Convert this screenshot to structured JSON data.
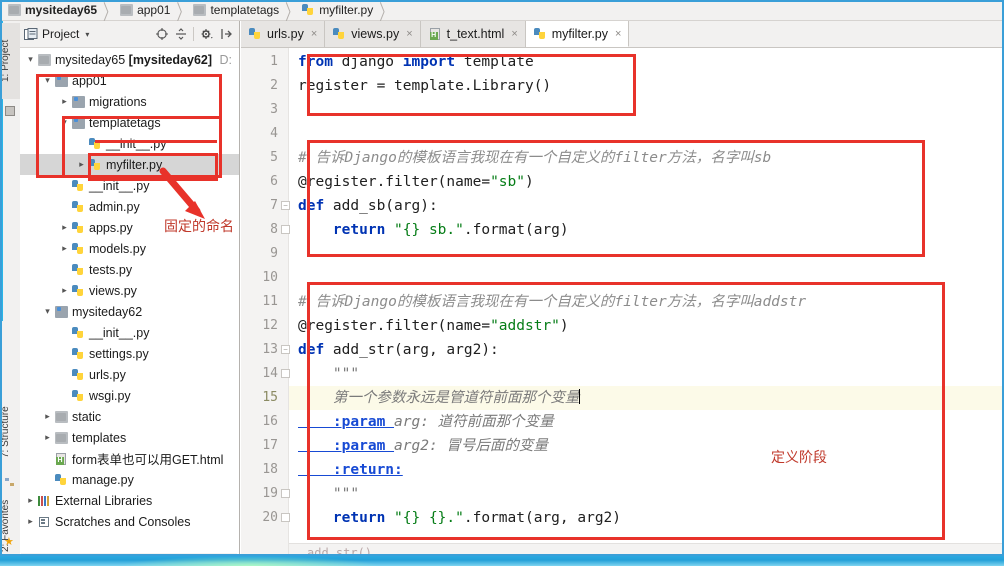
{
  "breadcrumb": {
    "items": [
      {
        "label": "mysiteday65",
        "icon": "folder-icon"
      },
      {
        "label": "app01",
        "icon": "folder-icon"
      },
      {
        "label": "templatetags",
        "icon": "folder-icon"
      },
      {
        "label": "myfilter.py",
        "icon": "python-file-icon"
      }
    ],
    "separator": "〉"
  },
  "toolstrip": {
    "project_tab": "1: Project",
    "structure_tab": "7: Structure",
    "favorites_tab": "2: Favorites",
    "star_icon": "★"
  },
  "project_panel": {
    "title": "Project",
    "caret": "▾",
    "toolbar_icons": [
      "target-icon",
      "collapse-all-icon",
      "settings-icon",
      "hide-icon"
    ],
    "tree": [
      {
        "label": "mysiteday65 ",
        "bold": "mysiteday62",
        "suffix": " D:",
        "indent": 0,
        "twist": "⌄",
        "icon": "folder-icon",
        "selected": false
      },
      {
        "label": "app01",
        "indent": 1,
        "twist": "⌄",
        "icon": "folder-blue-icon",
        "selected": false
      },
      {
        "label": "migrations",
        "indent": 2,
        "twist": "›",
        "icon": "folder-blue-icon",
        "selected": false
      },
      {
        "label": "templatetags",
        "indent": 2,
        "twist": "⌄",
        "icon": "folder-blue-icon",
        "selected": false
      },
      {
        "label": "__init__.py",
        "indent": 3,
        "twist": "",
        "icon": "python-file-icon",
        "selected": false
      },
      {
        "label": "myfilter.py",
        "indent": 3,
        "twist": "›",
        "icon": "python-file-icon",
        "selected": true
      },
      {
        "label": "__init__.py",
        "indent": 2,
        "twist": "",
        "icon": "python-file-icon",
        "selected": false
      },
      {
        "label": "admin.py",
        "indent": 2,
        "twist": "",
        "icon": "python-file-icon",
        "selected": false
      },
      {
        "label": "apps.py",
        "indent": 2,
        "twist": "›",
        "icon": "python-file-icon",
        "selected": false
      },
      {
        "label": "models.py",
        "indent": 2,
        "twist": "›",
        "icon": "python-file-icon",
        "selected": false
      },
      {
        "label": "tests.py",
        "indent": 2,
        "twist": "",
        "icon": "python-file-icon",
        "selected": false
      },
      {
        "label": "views.py",
        "indent": 2,
        "twist": "›",
        "icon": "python-file-icon",
        "selected": false
      },
      {
        "label": "mysiteday62",
        "indent": 1,
        "twist": "⌄",
        "icon": "folder-blue-icon",
        "selected": false
      },
      {
        "label": "__init__.py",
        "indent": 2,
        "twist": "",
        "icon": "python-file-icon",
        "selected": false
      },
      {
        "label": "settings.py",
        "indent": 2,
        "twist": "",
        "icon": "python-file-icon",
        "selected": false
      },
      {
        "label": "urls.py",
        "indent": 2,
        "twist": "",
        "icon": "python-file-icon",
        "selected": false
      },
      {
        "label": "wsgi.py",
        "indent": 2,
        "twist": "",
        "icon": "python-file-icon",
        "selected": false
      },
      {
        "label": "static",
        "indent": 1,
        "twist": "›",
        "icon": "folder-icon",
        "selected": false
      },
      {
        "label": "templates",
        "indent": 1,
        "twist": "›",
        "icon": "folder-icon",
        "selected": false
      },
      {
        "label": "form表单也可以用GET.html",
        "indent": 1,
        "twist": "",
        "icon": "html-file-icon",
        "selected": false
      },
      {
        "label": "manage.py",
        "indent": 1,
        "twist": "",
        "icon": "python-file-icon",
        "selected": false
      },
      {
        "label": "External Libraries",
        "indent": 0,
        "twist": "›",
        "icon": "library-icon",
        "selected": false
      },
      {
        "label": "Scratches and Consoles",
        "indent": 0,
        "twist": "›",
        "icon": "scratch-icon",
        "selected": false
      }
    ]
  },
  "editor": {
    "tabs": [
      {
        "label": "urls.py",
        "icon": "python-file-icon",
        "active": false,
        "close": "×"
      },
      {
        "label": "views.py",
        "icon": "python-file-icon",
        "active": false,
        "close": "×"
      },
      {
        "label": "t_text.html",
        "icon": "html-file-icon",
        "active": false,
        "close": "×"
      },
      {
        "label": "myfilter.py",
        "icon": "python-file-icon",
        "active": true,
        "close": "×"
      }
    ],
    "line_numbers": [
      1,
      2,
      3,
      4,
      5,
      6,
      7,
      8,
      9,
      10,
      11,
      12,
      13,
      14,
      15,
      16,
      17,
      18,
      19,
      20
    ],
    "current_line": 15,
    "code_lines": [
      {
        "n": 1,
        "segments": [
          {
            "t": "from ",
            "c": "kw"
          },
          {
            "t": "django ",
            "c": ""
          },
          {
            "t": "import ",
            "c": "kw"
          },
          {
            "t": "template",
            "c": ""
          }
        ]
      },
      {
        "n": 2,
        "segments": [
          {
            "t": "register = template.Library()",
            "c": ""
          }
        ]
      },
      {
        "n": 3,
        "segments": []
      },
      {
        "n": 4,
        "segments": []
      },
      {
        "n": 5,
        "segments": [
          {
            "t": "# 告诉Django的模板语言我现在有一个自定义的filter方法，名字叫sb",
            "c": "cmt"
          }
        ]
      },
      {
        "n": 6,
        "segments": [
          {
            "t": "@register.filter(name=",
            "c": ""
          },
          {
            "t": "\"sb\"",
            "c": "str"
          },
          {
            "t": ")",
            "c": ""
          }
        ]
      },
      {
        "n": 7,
        "segments": [
          {
            "t": "def ",
            "c": "kw"
          },
          {
            "t": "add_sb(arg):",
            "c": ""
          }
        ]
      },
      {
        "n": 8,
        "segments": [
          {
            "t": "    return ",
            "c": "kw"
          },
          {
            "t": "\"{} sb.\"",
            "c": "str"
          },
          {
            "t": ".format(arg)",
            "c": ""
          }
        ]
      },
      {
        "n": 9,
        "segments": []
      },
      {
        "n": 10,
        "segments": []
      },
      {
        "n": 11,
        "segments": [
          {
            "t": "# 告诉Django的模板语言我现在有一个自定义的filter方法，名字叫addstr",
            "c": "cmt"
          }
        ]
      },
      {
        "n": 12,
        "segments": [
          {
            "t": "@register.filter(name=",
            "c": ""
          },
          {
            "t": "\"addstr\"",
            "c": "str"
          },
          {
            "t": ")",
            "c": ""
          }
        ]
      },
      {
        "n": 13,
        "segments": [
          {
            "t": "def ",
            "c": "kw"
          },
          {
            "t": "add_str(arg, arg2):",
            "c": ""
          }
        ]
      },
      {
        "n": 14,
        "segments": [
          {
            "t": "    \"\"\"",
            "c": "doc"
          }
        ]
      },
      {
        "n": 15,
        "segments": [
          {
            "t": "    第一个参数永远是管道符前面那个变量",
            "c": "doc"
          }
        ]
      },
      {
        "n": 16,
        "segments": [
          {
            "t": "    :param ",
            "c": "tagp"
          },
          {
            "t": "arg: 道符前面那个变量",
            "c": "doc"
          }
        ]
      },
      {
        "n": 17,
        "segments": [
          {
            "t": "    :param ",
            "c": "tagp"
          },
          {
            "t": "arg2: 冒号后面的变量",
            "c": "doc"
          }
        ]
      },
      {
        "n": 18,
        "segments": [
          {
            "t": "    :return:",
            "c": "tagp"
          }
        ]
      },
      {
        "n": 19,
        "segments": [
          {
            "t": "    \"\"\"",
            "c": "doc"
          }
        ]
      },
      {
        "n": 20,
        "segments": [
          {
            "t": "    return ",
            "c": "kw"
          },
          {
            "t": "\"{} {}.\"",
            "c": "str"
          },
          {
            "t": ".format(arg, arg2)",
            "c": ""
          }
        ]
      }
    ],
    "status_breadcrumb": "add_str()"
  },
  "annotations": [
    {
      "text": "固定的命名",
      "name": "annotation-fixed-naming"
    },
    {
      "text": "定义阶段",
      "name": "annotation-definition-stage"
    }
  ],
  "colors": {
    "annotation_red": "#e8322a",
    "annotation_text": "#c0392b",
    "keyword": "#0033b3",
    "string": "#067d17",
    "comment": "#8c8c8c",
    "selection": "#d6d6d6",
    "current_line": "#fcfae8"
  }
}
